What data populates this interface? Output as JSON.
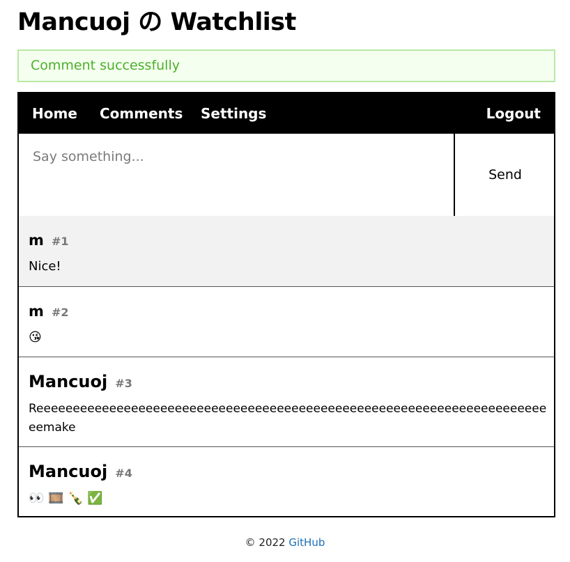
{
  "page": {
    "title": "Mancuoj の Watchlist"
  },
  "flash": {
    "message": "Comment successfully"
  },
  "nav": {
    "home": "Home",
    "comments": "Comments",
    "settings": "Settings",
    "logout": "Logout"
  },
  "composer": {
    "placeholder": "Say something...",
    "value": "",
    "send_label": "Send"
  },
  "comments": [
    {
      "author": "m",
      "number": "#1",
      "text": "Nice!"
    },
    {
      "author": "m",
      "number": "#2",
      "text": "😘"
    },
    {
      "author": "Mancuoj",
      "number": "#3",
      "text": "Reeeeeeeeeeeeeeeeeeeeeeeeeeeeeeeeeeeeeeeeeeeeeeeeeeeeeeeeeeeeeeeeeeeeeeeemake"
    },
    {
      "author": "Mancuoj",
      "number": "#4",
      "text": "👀 🎞️ 🍾 ✅"
    }
  ],
  "footer": {
    "copyright": "© 2022",
    "link_label": "GitHub"
  },
  "colors": {
    "flash_border": "#b9e8a3",
    "flash_text": "#4caf2b",
    "nav_bg": "#000000",
    "highlight_row": "#f2f2f2",
    "link": "#1a6fb7"
  }
}
